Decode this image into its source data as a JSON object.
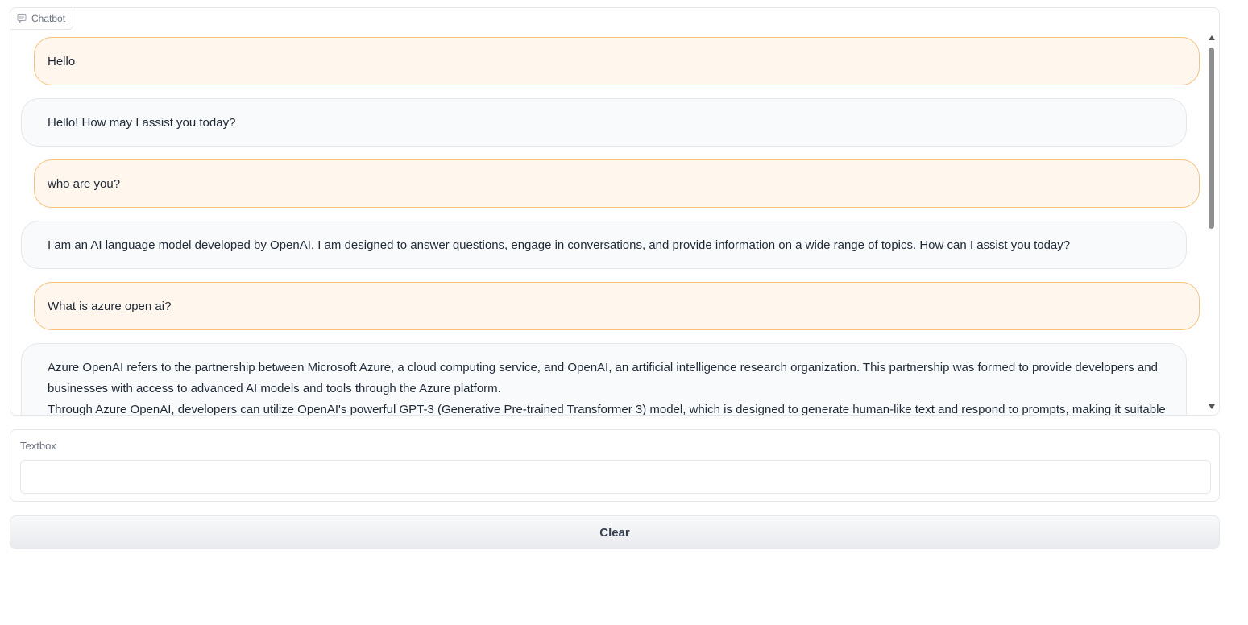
{
  "chatbot": {
    "label": "Chatbot",
    "icon": "chat-icon",
    "messages": [
      {
        "role": "user",
        "lines": [
          "Hello"
        ]
      },
      {
        "role": "bot",
        "lines": [
          "Hello! How may I assist you today?"
        ]
      },
      {
        "role": "user",
        "lines": [
          "who are you?"
        ]
      },
      {
        "role": "bot",
        "lines": [
          "I am an AI language model developed by OpenAI. I am designed to answer questions, engage in conversations, and provide information on a wide range of topics. How can I assist you today?"
        ]
      },
      {
        "role": "user",
        "lines": [
          "What is azure open ai?"
        ]
      },
      {
        "role": "bot",
        "lines": [
          "Azure OpenAI refers to the partnership between Microsoft Azure, a cloud computing service, and OpenAI, an artificial intelligence research organization. This partnership was formed to provide developers and",
          "businesses with access to advanced AI models and tools through the Azure platform.",
          "Through Azure OpenAI, developers can utilize OpenAI's powerful GPT-3 (Generative Pre-trained Transformer 3) model, which is designed to generate human-like text and respond to prompts, making it suitable"
        ]
      }
    ]
  },
  "textbox": {
    "label": "Textbox",
    "value": "",
    "placeholder": ""
  },
  "clear_button": {
    "label": "Clear"
  },
  "colors": {
    "user_bubble_bg": "#fff7ed",
    "user_bubble_border": "#f3c37a",
    "bot_bubble_bg": "#f9fafb"
  }
}
